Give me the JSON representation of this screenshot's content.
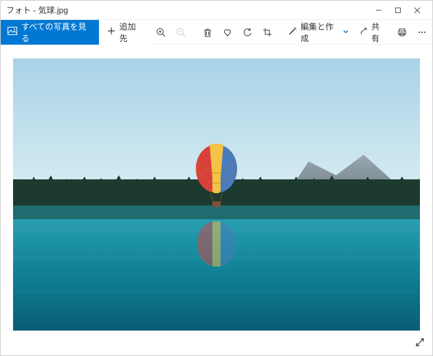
{
  "window": {
    "title": "フォト - 気球.jpg"
  },
  "toolbar": {
    "see_all_label": "すべての写真を見る",
    "add_to_label": "追加先",
    "edit_create_label": "編集と作成",
    "share_label": "共有"
  },
  "icons": {
    "photo_icon": "photo-icon",
    "plus_icon": "plus-icon",
    "zoom_in_icon": "zoom-in-icon",
    "zoom_out_icon": "zoom-out-icon",
    "delete_icon": "trash-icon",
    "favorite_icon": "heart-icon",
    "rotate_icon": "rotate-icon",
    "crop_icon": "crop-icon",
    "magic_icon": "magic-wand-icon",
    "share_icon": "share-icon",
    "print_icon": "print-icon",
    "more_icon": "more-icon",
    "fullscreen_icon": "diagonal-arrows-icon",
    "dropdown_icon": "chevron-down-icon",
    "minimize_icon": "minimize-icon",
    "maximize_icon": "maximize-icon",
    "close_icon": "close-icon"
  },
  "image": {
    "description": "Hot air balloon over lake with forest and mountains",
    "colors": {
      "sky_top": "#a8d2e7",
      "sky_bottom": "#dbeef3",
      "water_top": "#2fa6b7",
      "water_bottom": "#085d75",
      "forest": "#1c3a2e",
      "mountain": "#7d8a92",
      "balloon_red": "#d9403a",
      "balloon_yellow": "#f3c246",
      "balloon_blue": "#4a7bbf"
    }
  }
}
